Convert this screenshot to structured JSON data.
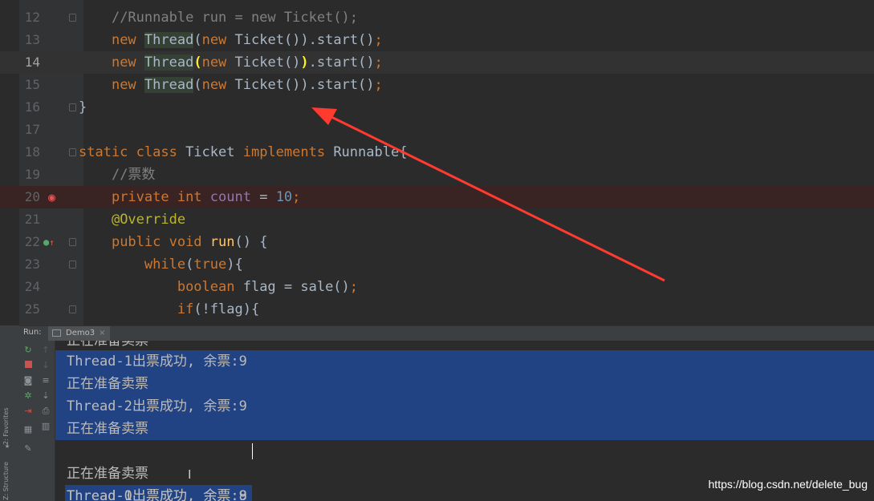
{
  "editor": {
    "lines": [
      {
        "num": "12",
        "text": "    //Runnable run = new Ticket();"
      },
      {
        "num": "13",
        "text": "    new Thread(new Ticket()).start();"
      },
      {
        "num": "14",
        "text": "    new Thread(new Ticket()).start();"
      },
      {
        "num": "15",
        "text": "    new Thread(new Ticket()).start();"
      },
      {
        "num": "16",
        "text": "}"
      },
      {
        "num": "17",
        "text": ""
      },
      {
        "num": "18",
        "text": "static class Ticket implements Runnable{"
      },
      {
        "num": "19",
        "text": "    //票数"
      },
      {
        "num": "20",
        "text": "    private int count = 10;"
      },
      {
        "num": "21",
        "text": "    @Override"
      },
      {
        "num": "22",
        "text": "    public void run() {"
      },
      {
        "num": "23",
        "text": "        while(true){"
      },
      {
        "num": "24",
        "text": "            boolean flag = sale();"
      },
      {
        "num": "25",
        "text": "            if(!flag){"
      }
    ]
  },
  "run_panel": {
    "label": "Run:",
    "tab_name": "Demo3",
    "tab_close": "×"
  },
  "side_labels": {
    "favorites": "2: Favorites",
    "structure": "Z: Structure"
  },
  "console": {
    "lines": [
      "正在准备卖票",
      "Thread-1出票成功, 余票:9",
      "正在准备卖票",
      "Thread-2出票成功, 余票:9",
      "正在准备卖票",
      "Thread-0出票成功, 余票:9",
      "正在准备卖票",
      "Thread-1出票成功, 余票:8"
    ]
  },
  "watermark": "https://blog.csdn.net/delete_bug",
  "colors": {
    "arrow": "#ff3b30",
    "selection": "#214283",
    "breakpoint": "#e05555"
  }
}
